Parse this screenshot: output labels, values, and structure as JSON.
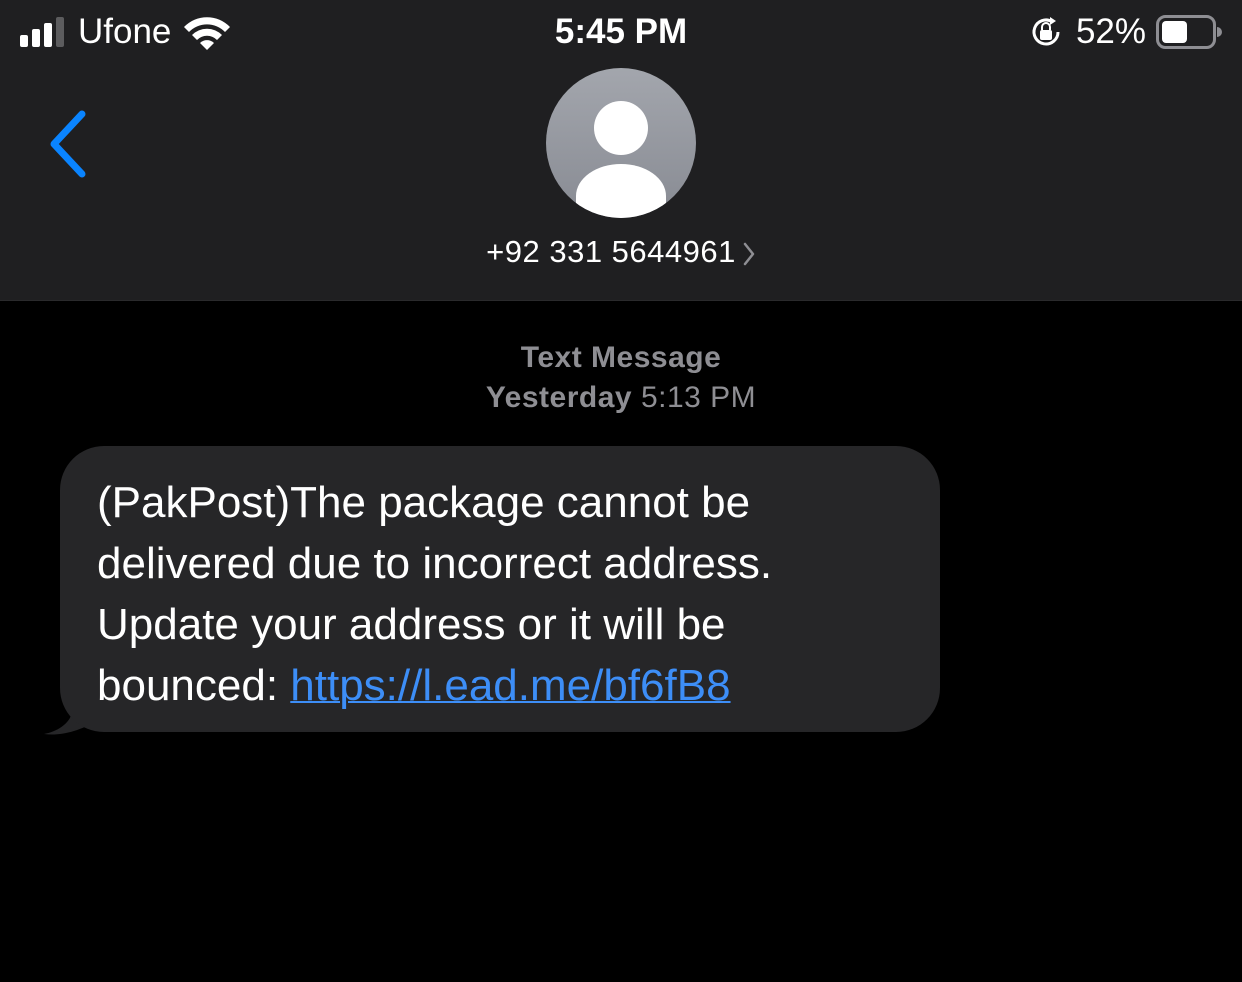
{
  "status_bar": {
    "carrier": "Ufone",
    "time": "5:45 PM",
    "battery_percent": "52%",
    "battery_level": 0.52,
    "signal_bars_filled": 3,
    "signal_bars_total": 4
  },
  "nav": {
    "back_icon": "chevron-left-icon",
    "contact_name": "+92 331 5644961",
    "contact_chevron_icon": "chevron-right-icon",
    "avatar_icon": "person-icon"
  },
  "conversation": {
    "service_label": "Text Message",
    "timestamp_day": "Yesterday",
    "timestamp_time": "5:13 PM",
    "messages": [
      {
        "direction": "incoming",
        "text": "(PakPost)The package cannot be delivered due to incorrect address. Update your address or it will be bounced: ",
        "link": "https://l.ead.me/bf6fB8"
      }
    ]
  },
  "colors": {
    "header_bg": "#1f1f21",
    "background": "#000000",
    "bubble_incoming": "#262628",
    "accent_blue": "#0a84ff",
    "link": "#3d8ef7",
    "meta_text": "#8e8e93"
  }
}
